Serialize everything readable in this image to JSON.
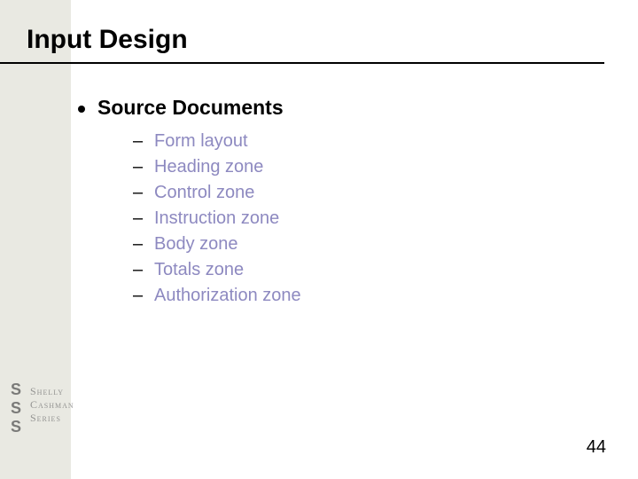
{
  "title": "Input Design",
  "bullet": "Source Documents",
  "subitems": [
    "Form layout",
    "Heading zone",
    "Control zone",
    "Instruction zone",
    "Body zone",
    "Totals zone",
    "Authorization zone"
  ],
  "logo": {
    "line1": "Shelly",
    "line2": "Cashman",
    "line3": "Series"
  },
  "page_number": "44"
}
